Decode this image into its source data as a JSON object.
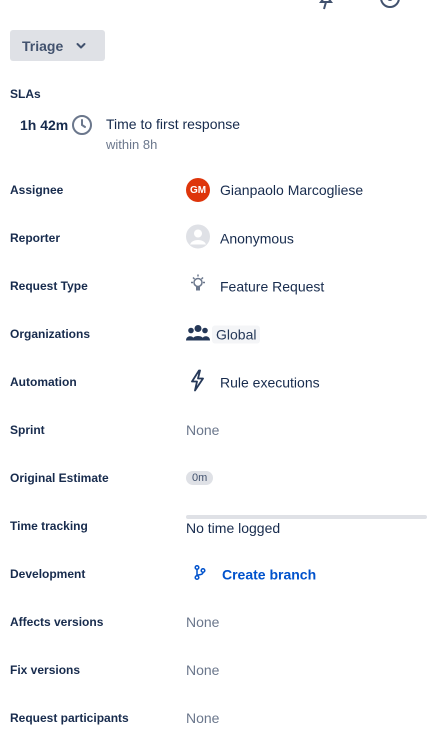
{
  "header": {
    "icons": [
      "pin-icon",
      "eye-icon"
    ]
  },
  "status": {
    "label": "Triage"
  },
  "sla": {
    "title": "SLAs",
    "time_remaining": "1h 42m",
    "name": "Time to first response",
    "goal": "within 8h"
  },
  "fields": {
    "assignee": {
      "label": "Assignee",
      "value": "Gianpaolo Marcogliese",
      "initials": "GM"
    },
    "reporter": {
      "label": "Reporter",
      "value": "Anonymous"
    },
    "request_type": {
      "label": "Request Type",
      "value": "Feature Request"
    },
    "organizations": {
      "label": "Organizations",
      "value": "Global"
    },
    "automation": {
      "label": "Automation",
      "value": "Rule executions"
    },
    "sprint": {
      "label": "Sprint",
      "value": "None"
    },
    "original_estimate": {
      "label": "Original Estimate",
      "value": "0m"
    },
    "time_tracking": {
      "label": "Time tracking",
      "value": "No time logged"
    },
    "development": {
      "label": "Development",
      "value": "Create branch"
    },
    "affects_versions": {
      "label": "Affects versions",
      "value": "None"
    },
    "fix_versions": {
      "label": "Fix versions",
      "value": "None"
    },
    "request_participants": {
      "label": "Request participants",
      "value": "None"
    }
  },
  "colors": {
    "avatar_bg": "#de350b",
    "link": "#0052cc",
    "muted_text": "#6b778c",
    "status_bg": "#dfe1e6"
  }
}
